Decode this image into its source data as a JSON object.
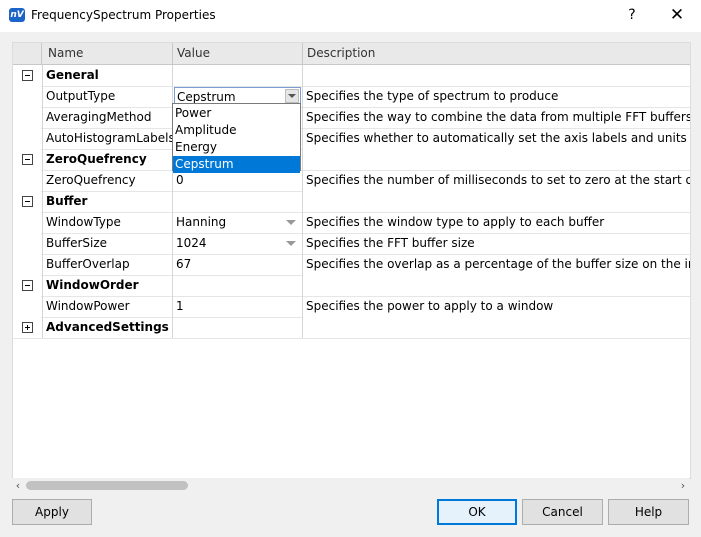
{
  "window": {
    "title": "FrequencySpectrum Properties",
    "icon_text": "nV",
    "help_glyph": "?",
    "close_glyph": "✕"
  },
  "grid": {
    "columns": [
      "Name",
      "Value",
      "Description"
    ],
    "rows": [
      {
        "type": "category",
        "expanded": true,
        "name": "General",
        "value": "",
        "description": ""
      },
      {
        "type": "property",
        "name": "OutputType",
        "value": "Cepstrum",
        "description": "Specifies the type of spectrum to produce",
        "editor": "dropdown-open"
      },
      {
        "type": "property",
        "name": "AveragingMethod",
        "value": "",
        "description": "Specifies the way to combine the data from multiple FFT buffers"
      },
      {
        "type": "property",
        "name": "AutoHistogramLabels",
        "value": "",
        "description": "Specifies whether to automatically set the axis labels and units text or"
      },
      {
        "type": "category",
        "expanded": true,
        "name": "ZeroQuefrency",
        "value": "",
        "description": ""
      },
      {
        "type": "property",
        "name": "ZeroQuefrency",
        "value": "0",
        "description": "Specifies the number of milliseconds to set to zero at the start of the C"
      },
      {
        "type": "category",
        "expanded": true,
        "name": "Buffer",
        "value": "",
        "description": ""
      },
      {
        "type": "property",
        "name": "WindowType",
        "value": "Hanning",
        "description": "Specifies the window type to apply to each buffer",
        "editor": "dropdown"
      },
      {
        "type": "property",
        "name": "BufferSize",
        "value": "1024",
        "description": "Specifies the FFT buffer size",
        "editor": "dropdown"
      },
      {
        "type": "property",
        "name": "BufferOverlap",
        "value": "67",
        "description": "Specifies the overlap as a percentage of the buffer size on the input d"
      },
      {
        "type": "category",
        "expanded": true,
        "name": "WindowOrder",
        "value": "",
        "description": ""
      },
      {
        "type": "property",
        "name": "WindowPower",
        "value": "1",
        "description": "Specifies the power to apply to a window"
      },
      {
        "type": "category",
        "expanded": false,
        "name": "AdvancedSettings",
        "value": "",
        "description": ""
      }
    ]
  },
  "dropdown": {
    "options": [
      "Power",
      "Amplitude",
      "Energy",
      "Cepstrum"
    ],
    "selected": "Cepstrum"
  },
  "scrollbar": {
    "left_arrow": "‹",
    "right_arrow": "›"
  },
  "buttons": {
    "apply": "Apply",
    "ok": "OK",
    "cancel": "Cancel",
    "help": "Help"
  }
}
